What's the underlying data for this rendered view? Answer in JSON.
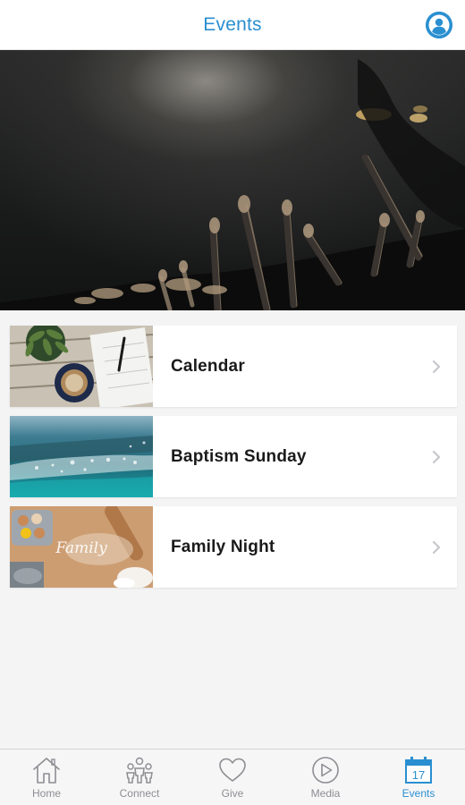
{
  "header": {
    "title": "Events",
    "accent_color": "#2a8fd0"
  },
  "hero": {
    "image": "worship-hands-raised-photo"
  },
  "events": [
    {
      "label": "Calendar",
      "thumbnail": "desk-planner-coffee-photo"
    },
    {
      "label": "Baptism Sunday",
      "thumbnail": "ocean-waves-photo"
    },
    {
      "label": "Family Night",
      "thumbnail": "family-baking-flour-photo"
    }
  ],
  "tabbar": {
    "tabs": [
      {
        "label": "Home",
        "icon": "home-icon",
        "active": false
      },
      {
        "label": "Connect",
        "icon": "people-icon",
        "active": false
      },
      {
        "label": "Give",
        "icon": "heart-icon",
        "active": false
      },
      {
        "label": "Media",
        "icon": "play-icon",
        "active": false
      },
      {
        "label": "Events",
        "icon": "calendar-icon",
        "active": true,
        "badge": "17"
      }
    ]
  }
}
